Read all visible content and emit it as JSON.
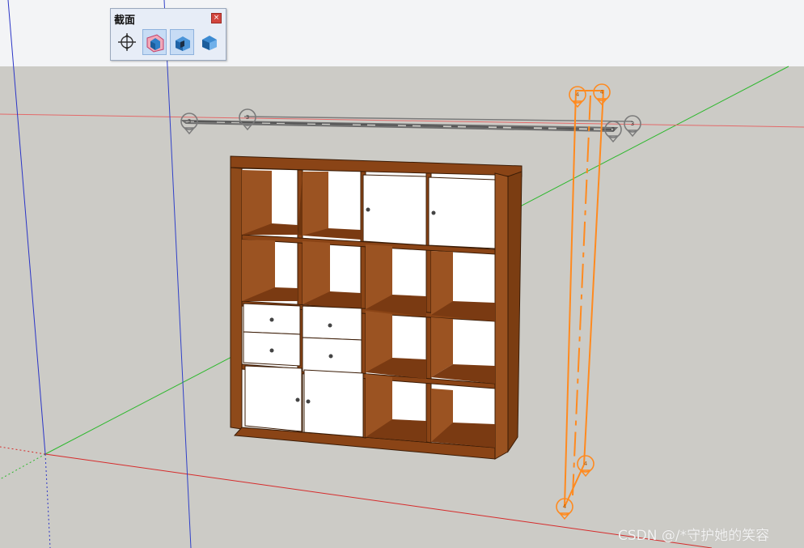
{
  "app": "SketchUp",
  "toolbar": {
    "title": "截面",
    "close_glyph": "×",
    "tools": [
      {
        "name": "section-plane-tool",
        "icon": "section-plane-icon",
        "active": false
      },
      {
        "name": "display-section-planes",
        "icon": "display-section-planes-icon",
        "active": true
      },
      {
        "name": "display-section-cuts",
        "icon": "display-section-cuts-icon",
        "active": true
      },
      {
        "name": "display-section-fill",
        "icon": "display-section-fill-icon",
        "active": false
      }
    ]
  },
  "section_planes": [
    {
      "label": "3",
      "color": "#7a7a7a"
    },
    {
      "label": "3",
      "color": "#7a7a7a"
    },
    {
      "label": "3",
      "color": "#7a7a7a"
    },
    {
      "label": "3",
      "color": "#7a7a7a"
    },
    {
      "label": "4",
      "color": "#ff8a1f"
    },
    {
      "label": "4",
      "color": "#ff8a1f"
    },
    {
      "label": "4",
      "color": "#ff8a1f"
    },
    {
      "label": "4",
      "color": "#ff8a1f"
    }
  ],
  "model": {
    "name": "cube-storage-shelf",
    "grid": "4x4",
    "wood_color": "#9a4f1c",
    "door_color": "#ffffff"
  },
  "axes": {
    "red": "#d62b2b",
    "green": "#2eb82e",
    "blue": "#2b35c7"
  },
  "watermark": "CSDN @/*守护她的笑容"
}
